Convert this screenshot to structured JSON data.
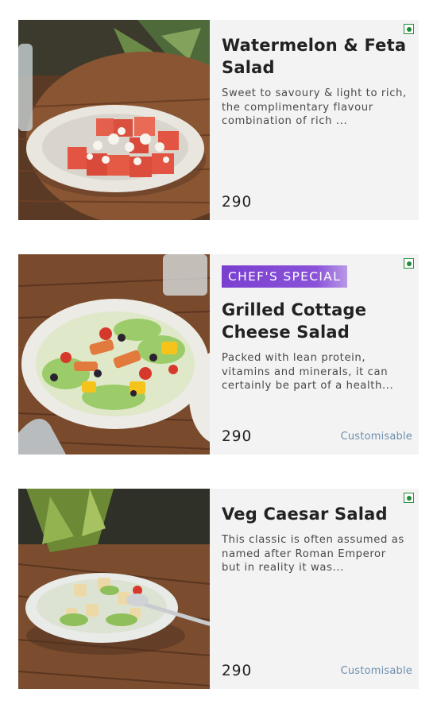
{
  "items": [
    {
      "title": "Watermelon & Feta Salad",
      "description": "Sweet to savoury & light to rich, the complimentary flavour combination of rich ...",
      "price": "290",
      "badge": "",
      "customisable": "",
      "veg": true,
      "image_icon": "watermelon-feta-salad-photo"
    },
    {
      "title": "Grilled Cottage Cheese Salad",
      "description": "Packed with lean protein, vitamins and minerals, it can certainly be part of a health...",
      "price": "290",
      "badge": "CHEF'S SPECIAL",
      "customisable": "Customisable",
      "veg": true,
      "image_icon": "grilled-cottage-cheese-salad-photo"
    },
    {
      "title": "Veg Caesar Salad",
      "description": "This classic is often assumed as named after Roman Emperor but in reality it was...",
      "price": "290",
      "badge": "",
      "customisable": "Customisable",
      "veg": true,
      "image_icon": "veg-caesar-salad-photo"
    }
  ],
  "colors": {
    "veg_green": "#1e8c3a",
    "badge_purple": "#7a3fd0",
    "customisable_blue": "#6d8fae",
    "card_bg": "#f3f3f3"
  }
}
